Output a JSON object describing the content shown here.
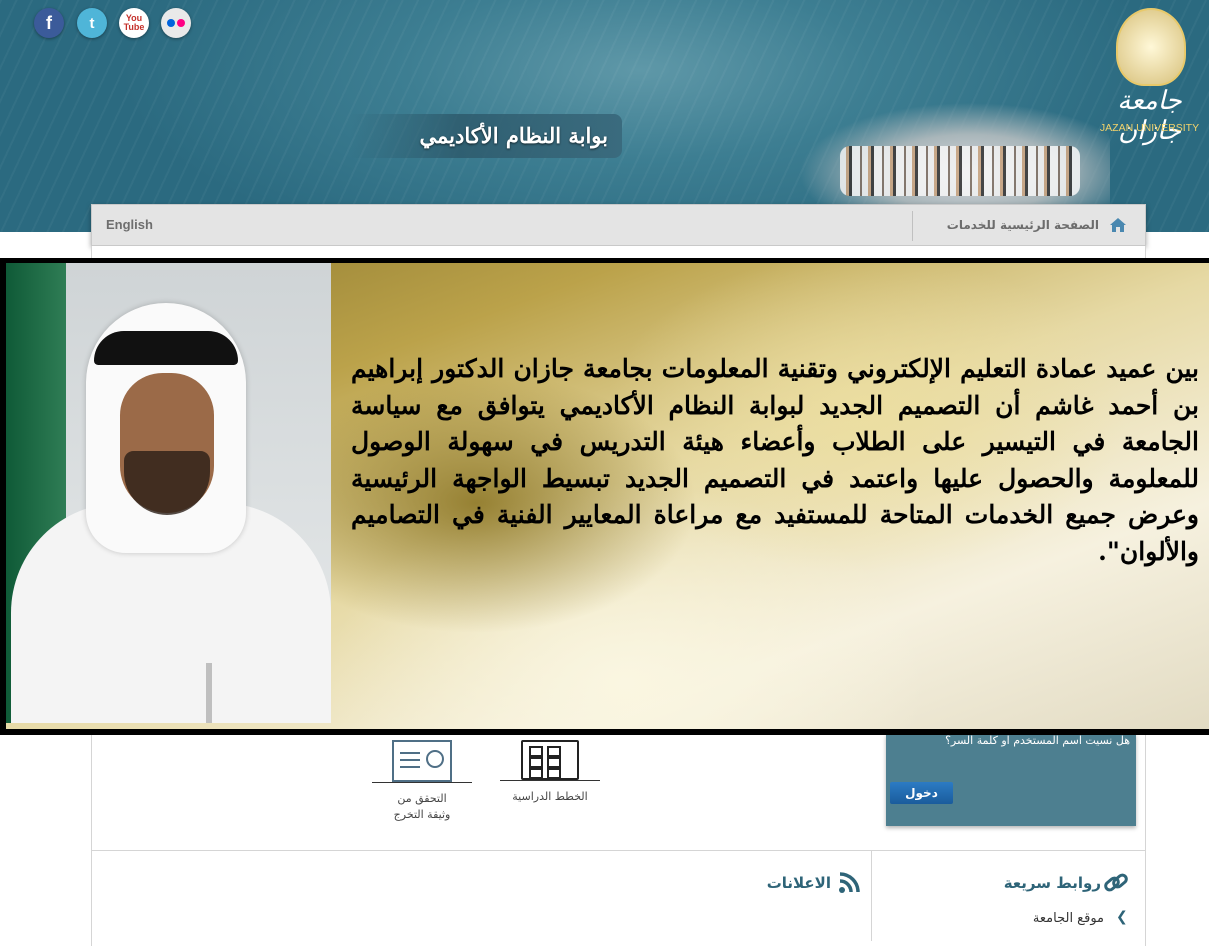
{
  "social": {
    "facebook": "f",
    "twitter": "t",
    "youtube": "You Tube",
    "flickr_icon": "flickr-icon"
  },
  "header": {
    "portal_title": "بوابة النظام الأكاديمي",
    "logo_arabic": "جامعة جازان",
    "logo_english": "JAZAN UNIVERSITY"
  },
  "nav": {
    "english": "English",
    "home": "الصفحة الرئيسية للخدمات"
  },
  "popup": {
    "quote": "بين عميد عمادة التعليم الإلكتروني وتقنية المعلومات بجامعة جازان الدكتور إبراهيم بن أحمد غاشم أن التصميم الجديد لبوابة النظام الأكاديمي يتوافق مع سياسة الجامعة في التيسير على الطلاب وأعضاء هيئة التدريس في سهولة الوصول للمعلومة والحصول عليها واعتمد في التصميم الجديد تبسيط الواجهة الرئيسية وعرض جميع الخدمات المتاحة للمستفيد مع مراعاة المعايير الفنية في التصاميم والألوان\"."
  },
  "login": {
    "forgot": "هل نسيت اسم المستخدم او كلمة السر؟",
    "button": "دخول"
  },
  "services": {
    "plans": "الخطط الدراسية",
    "verify_line1": "التحقق من",
    "verify_line2": "وثيقة التخرج"
  },
  "sections": {
    "announcements": "الاعلانات",
    "quick_links": "روابط سريعة",
    "university_site": "موقع الجامعة"
  },
  "colors": {
    "header_teal": "#3d7e92",
    "section_title": "#2e6478",
    "login_panel": "#4d7f90"
  }
}
